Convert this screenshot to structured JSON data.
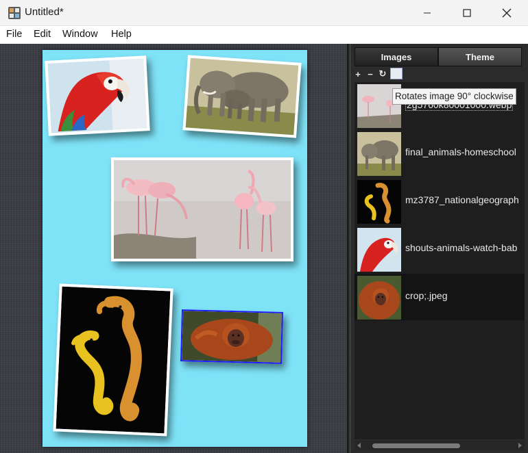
{
  "window": {
    "title": "Untitled*"
  },
  "menu": {
    "file": "File",
    "edit": "Edit",
    "window": "Window",
    "help": "Help"
  },
  "panel": {
    "tabs": {
      "images": "Images",
      "theme": "Theme"
    },
    "toolbar": {
      "add": "+",
      "remove": "−",
      "rotate": "↻"
    },
    "tooltip": "Rotates image 90° clockwise",
    "items": [
      {
        "label": "2g5760k80001000.webp",
        "thumb": "flamingo"
      },
      {
        "label": "final_animals-homeschool",
        "thumb": "elephant"
      },
      {
        "label": "mz3787_nationalgeograph",
        "thumb": "seahorse"
      },
      {
        "label": "shouts-animals-watch-bab",
        "thumb": "parrot"
      },
      {
        "label": "crop;.jpeg",
        "thumb": "orangutan"
      }
    ]
  },
  "canvas": {
    "page_color": "#7fe3f8",
    "background": "#3b3e44"
  },
  "colors": {
    "accent_selection": "#1a1aff"
  }
}
